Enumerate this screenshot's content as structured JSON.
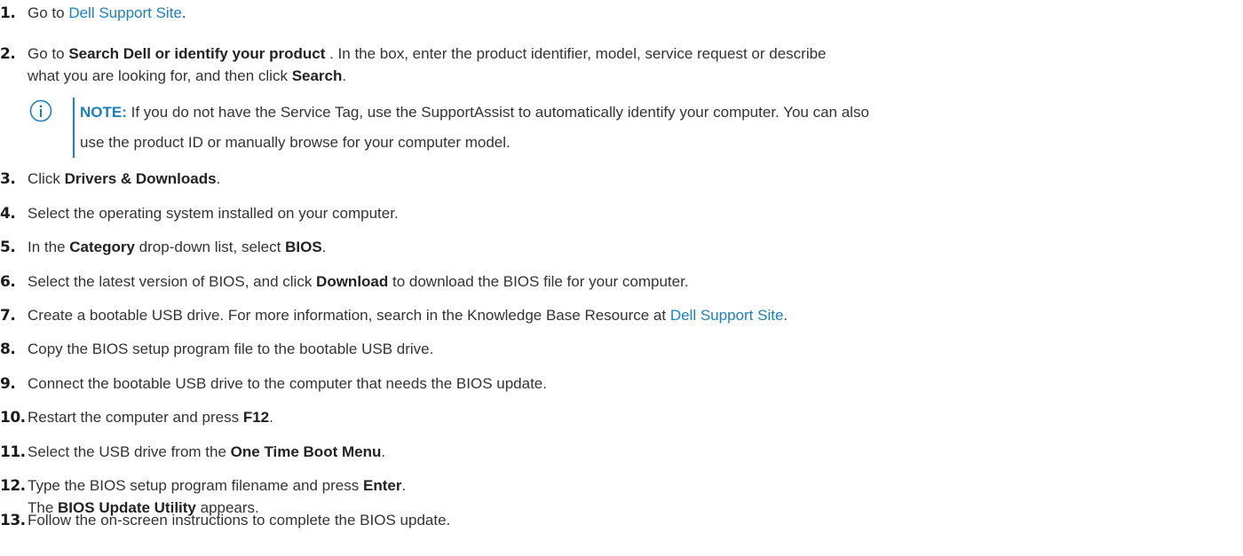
{
  "steps": [
    {
      "num": "1.",
      "parts": [
        {
          "t": "Go to "
        },
        {
          "t": "Dell Support Site",
          "link": true
        },
        {
          "t": "."
        }
      ]
    },
    {
      "num": "2.",
      "parts": [
        {
          "t": "Go to "
        },
        {
          "t": "Search Dell or identify your product",
          "b": true
        },
        {
          "t": " . In the box, enter the product identifier, model, service request or describe"
        }
      ],
      "cont": [
        {
          "t": "what you are looking for, and then click "
        },
        {
          "t": "Search",
          "b": true
        },
        {
          "t": "."
        }
      ]
    },
    {
      "num": "3.",
      "parts": [
        {
          "t": "Click "
        },
        {
          "t": "Drivers & Downloads",
          "b": true
        },
        {
          "t": "."
        }
      ]
    },
    {
      "num": "4.",
      "parts": [
        {
          "t": "Select the operating system installed on your computer."
        }
      ]
    },
    {
      "num": "5.",
      "parts": [
        {
          "t": "In the "
        },
        {
          "t": "Category",
          "b": true
        },
        {
          "t": " drop-down list, select "
        },
        {
          "t": "BIOS",
          "b": true
        },
        {
          "t": "."
        }
      ]
    },
    {
      "num": "6.",
      "parts": [
        {
          "t": "Select the latest version of BIOS, and click "
        },
        {
          "t": "Download",
          "b": true
        },
        {
          "t": " to download the BIOS file for your computer."
        }
      ]
    },
    {
      "num": "7.",
      "parts": [
        {
          "t": "Create a bootable USB drive. For more information, search in the Knowledge Base Resource at "
        },
        {
          "t": "Dell Support Site",
          "link": true
        },
        {
          "t": "."
        }
      ]
    },
    {
      "num": "8.",
      "parts": [
        {
          "t": "Copy the BIOS setup program file to the bootable USB drive."
        }
      ]
    },
    {
      "num": "9.",
      "parts": [
        {
          "t": "Connect the bootable USB drive to the computer that needs the BIOS update."
        }
      ]
    },
    {
      "num": "10.",
      "parts": [
        {
          "t": "Restart the computer and press "
        },
        {
          "t": "F12",
          "b": true
        },
        {
          "t": "."
        }
      ]
    },
    {
      "num": "11.",
      "parts": [
        {
          "t": "Select the USB drive from the "
        },
        {
          "t": "One Time Boot Menu",
          "b": true
        },
        {
          "t": "."
        }
      ]
    },
    {
      "num": "12.",
      "parts": [
        {
          "t": "Type the BIOS setup program filename and press "
        },
        {
          "t": "Enter",
          "b": true
        },
        {
          "t": "."
        }
      ],
      "cont": [
        {
          "t": "The "
        },
        {
          "t": "BIOS Update Utility",
          "b": true
        },
        {
          "t": " appears."
        }
      ]
    },
    {
      "num": "13.",
      "parts": [
        {
          "t": "Follow the on-screen instructions to complete the BIOS update."
        }
      ]
    }
  ],
  "note": {
    "label": "NOTE:",
    "line1": " If you do not have the Service Tag, use the SupportAssist to automatically identify your computer. You can also",
    "line2": "use the product ID or manually browse for your computer model.",
    "icon": "info-icon"
  },
  "colors": {
    "link": "#1c7fc1",
    "text": "#333333"
  }
}
